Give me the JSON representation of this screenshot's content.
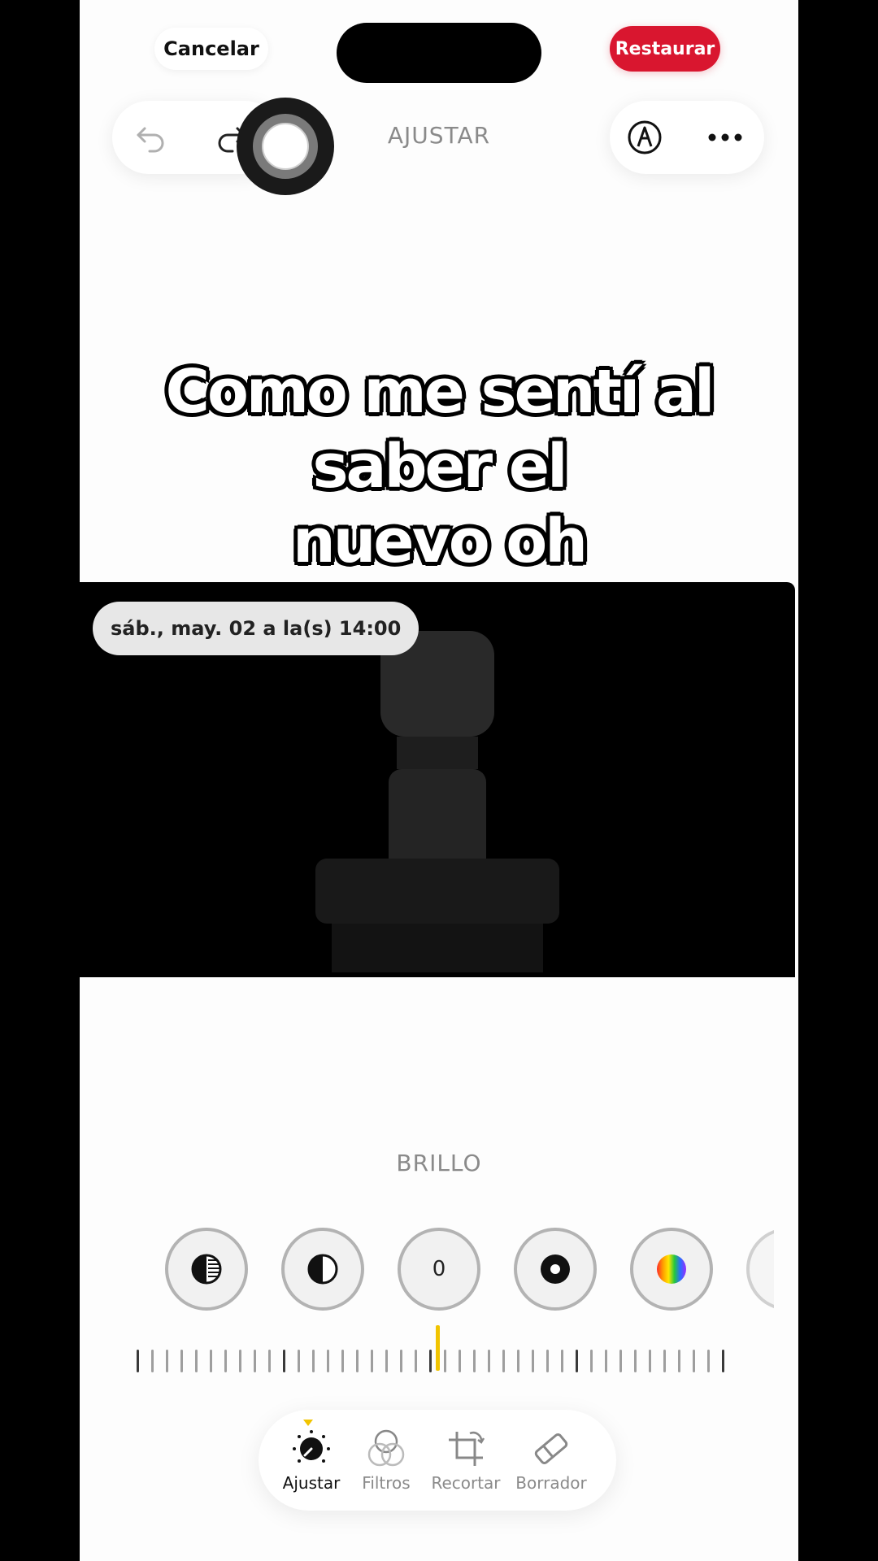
{
  "header": {
    "cancel_label": "Cancelar",
    "restore_label": "Restaurar",
    "mode_title": "AJUSTAR"
  },
  "caption": {
    "line1": "Como me sentí al saber el",
    "line2": "nuevo oh"
  },
  "photo": {
    "date_text": "sáb., may. 02 a la(s) 14:00"
  },
  "adjust": {
    "current_tool": "BRILLO",
    "brightness_value": "0",
    "tools": [
      "exposure-icon",
      "contrast-icon",
      "brightness-dial",
      "black-point-icon",
      "saturation-icon"
    ]
  },
  "tabbar": {
    "tabs": [
      {
        "label": "Ajustar",
        "icon": "adjust-dial-icon",
        "active": true
      },
      {
        "label": "Filtros",
        "icon": "filters-icon",
        "active": false
      },
      {
        "label": "Recortar",
        "icon": "crop-icon",
        "active": false
      },
      {
        "label": "Borrador",
        "icon": "eraser-icon",
        "active": false
      }
    ]
  },
  "colors": {
    "accent_red": "#d9162f",
    "accent_yellow": "#f1c400",
    "background": "#fdfdfd"
  }
}
